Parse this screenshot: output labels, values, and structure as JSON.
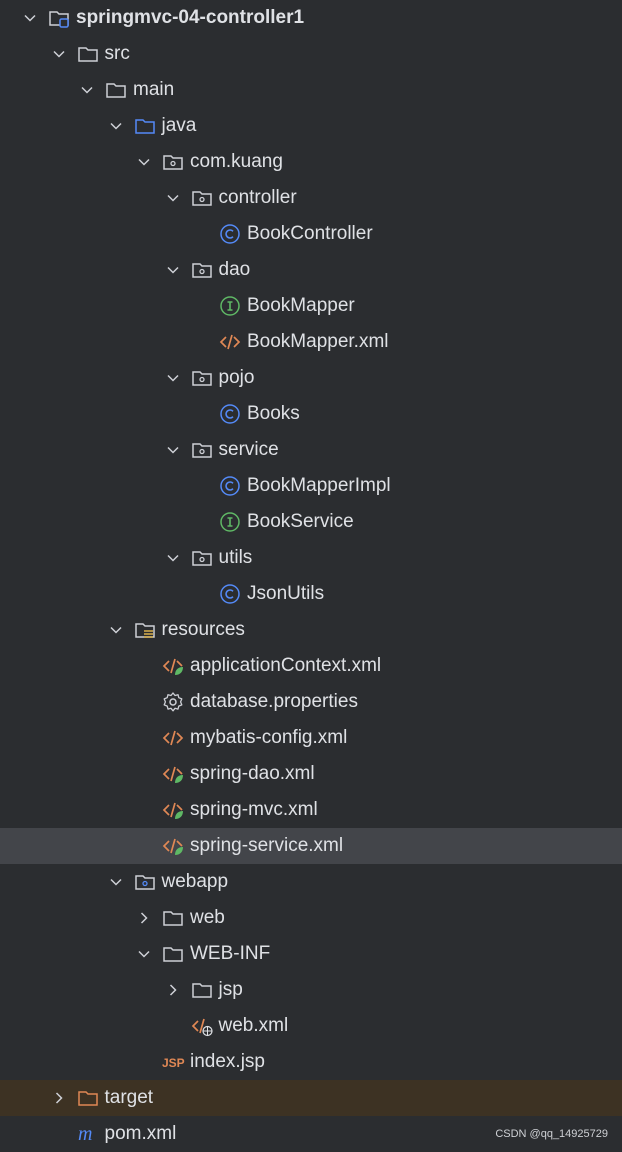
{
  "project_tree": {
    "items": [
      {
        "label": "springmvc-04-controller1",
        "icon": "module-folder-icon",
        "depth": 0,
        "expanded": true,
        "bold": true
      },
      {
        "label": "src",
        "icon": "folder-icon",
        "depth": 1,
        "expanded": true
      },
      {
        "label": "main",
        "icon": "folder-icon",
        "depth": 2,
        "expanded": true
      },
      {
        "label": "java",
        "icon": "source-folder-icon",
        "depth": 3,
        "expanded": true
      },
      {
        "label": "com.kuang",
        "icon": "package-icon",
        "depth": 4,
        "expanded": true
      },
      {
        "label": "controller",
        "icon": "package-icon",
        "depth": 5,
        "expanded": true
      },
      {
        "label": "BookController",
        "icon": "class-icon",
        "depth": 6
      },
      {
        "label": "dao",
        "icon": "package-icon",
        "depth": 5,
        "expanded": true
      },
      {
        "label": "BookMapper",
        "icon": "interface-icon",
        "depth": 6
      },
      {
        "label": "BookMapper.xml",
        "icon": "xml-icon",
        "depth": 6
      },
      {
        "label": "pojo",
        "icon": "package-icon",
        "depth": 5,
        "expanded": true
      },
      {
        "label": "Books",
        "icon": "class-icon",
        "depth": 6
      },
      {
        "label": "service",
        "icon": "package-icon",
        "depth": 5,
        "expanded": true
      },
      {
        "label": "BookMapperImpl",
        "icon": "class-icon",
        "depth": 6
      },
      {
        "label": "BookService",
        "icon": "interface-icon",
        "depth": 6
      },
      {
        "label": "utils",
        "icon": "package-icon",
        "depth": 5,
        "expanded": true
      },
      {
        "label": "JsonUtils",
        "icon": "class-icon",
        "depth": 6
      },
      {
        "label": "resources",
        "icon": "resources-folder-icon",
        "depth": 3,
        "expanded": true
      },
      {
        "label": "applicationContext.xml",
        "icon": "spring-xml-icon",
        "depth": 4
      },
      {
        "label": "database.properties",
        "icon": "gear-icon",
        "depth": 4
      },
      {
        "label": "mybatis-config.xml",
        "icon": "xml-icon",
        "depth": 4
      },
      {
        "label": "spring-dao.xml",
        "icon": "spring-xml-icon",
        "depth": 4
      },
      {
        "label": "spring-mvc.xml",
        "icon": "spring-xml-icon",
        "depth": 4
      },
      {
        "label": "spring-service.xml",
        "icon": "spring-xml-icon",
        "depth": 4,
        "selected": true
      },
      {
        "label": "webapp",
        "icon": "web-folder-icon",
        "depth": 3,
        "expanded": true
      },
      {
        "label": "web",
        "icon": "folder-icon",
        "depth": 4,
        "expanded": false
      },
      {
        "label": "WEB-INF",
        "icon": "folder-icon",
        "depth": 4,
        "expanded": true
      },
      {
        "label": "jsp",
        "icon": "folder-icon",
        "depth": 5,
        "expanded": false
      },
      {
        "label": "web.xml",
        "icon": "web-xml-icon",
        "depth": 5
      },
      {
        "label": "index.jsp",
        "icon": "jsp-icon",
        "depth": 4
      },
      {
        "label": "target",
        "icon": "excluded-folder-icon",
        "depth": 1,
        "expanded": false,
        "excluded": true
      },
      {
        "label": "pom.xml",
        "icon": "maven-icon",
        "depth": 1
      }
    ]
  },
  "watermark": "CSDN @qq_14925729",
  "colors": {
    "background": "#2b2d30",
    "selected_row": "#43454a",
    "excluded_row": "#3d3223",
    "text": "#dfe1e5",
    "class_blue": "#548af7",
    "interface_green": "#5fb865",
    "xml_orange": "#e08855",
    "folder_gray": "#ced0d6",
    "folder_orange": "#e08855"
  }
}
